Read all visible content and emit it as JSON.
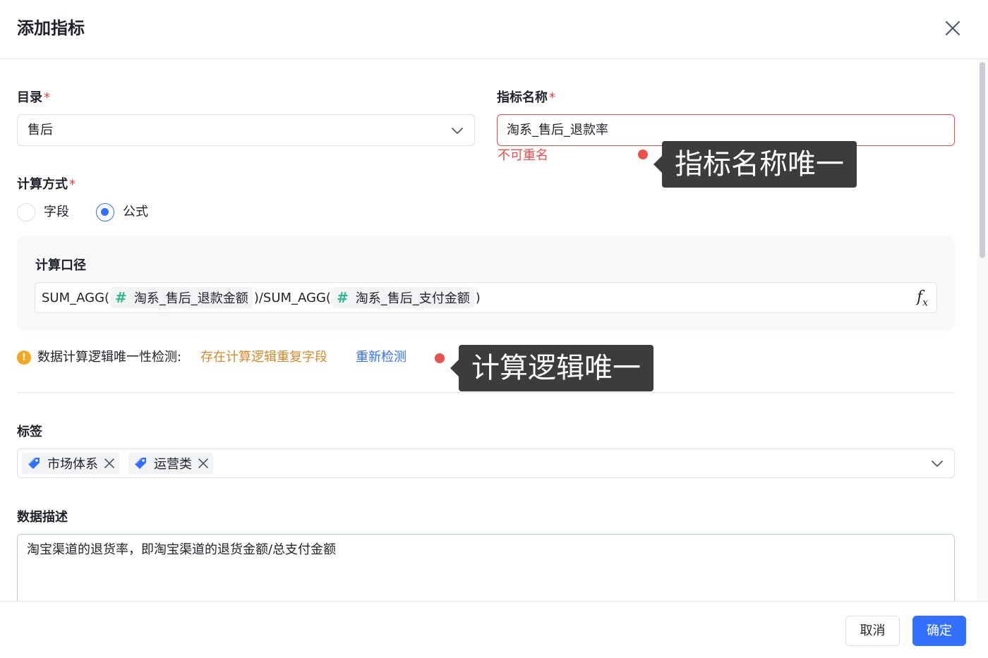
{
  "dialog": {
    "title": "添加指标"
  },
  "catalog": {
    "label": "目录",
    "required_mark": "*",
    "value": "售后"
  },
  "metric_name": {
    "label": "指标名称",
    "required_mark": "*",
    "value": "淘系_售后_退款率",
    "error": "不可重名"
  },
  "calc_method": {
    "label": "计算方式",
    "required_mark": "*",
    "options": [
      "字段",
      "公式"
    ],
    "selected": "公式"
  },
  "formula": {
    "label": "计算口径",
    "prefix": "SUM_AGG(",
    "field1": "淘系_售后_退款金额",
    "middle": ")/SUM_AGG(",
    "field2": "淘系_售后_支付金额",
    "suffix": ")",
    "field_icon": "#",
    "fx_icon": "fx"
  },
  "uniqueness_check": {
    "label": "数据计算逻辑唯一性检测:",
    "status": "存在计算逻辑重复字段",
    "recheck": "重新检测",
    "warning_icon": "!"
  },
  "annotations": {
    "name_unique": "指标名称唯一",
    "logic_unique": "计算逻辑唯一"
  },
  "tags": {
    "label": "标签",
    "items": [
      "市场体系",
      "运营类"
    ]
  },
  "description": {
    "label": "数据描述",
    "value": "淘宝渠道的退货率，即淘宝渠道的退货金额/总支付金额"
  },
  "footer": {
    "cancel": "取消",
    "ok": "确定"
  },
  "colors": {
    "primary": "#3370ff",
    "error": "#f04c4c",
    "warning": "#f5a623",
    "warning_text": "#d6892c",
    "field_hash": "#2fb98f",
    "annotation_bg": "#3c3c3c",
    "annotation_dot": "#e8524a"
  }
}
